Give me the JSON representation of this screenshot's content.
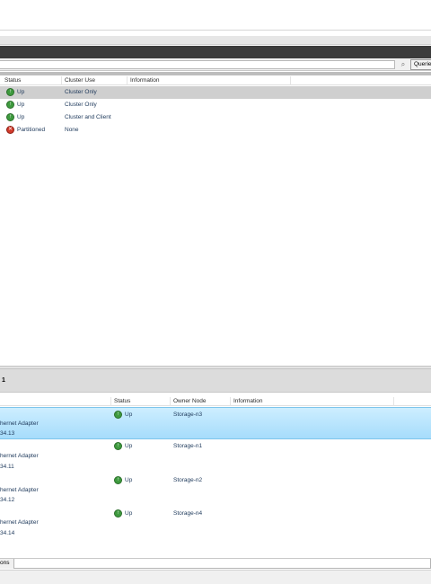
{
  "toolbar": {
    "queries_label": "Querie",
    "search_placeholder": ""
  },
  "networks": {
    "columns": [
      "Status",
      "Cluster Use",
      "Information"
    ],
    "rows": [
      {
        "status": "Up",
        "status_icon": "up-arrow-icon",
        "cluster_use": "Cluster Only",
        "information": ""
      },
      {
        "status": "Up",
        "status_icon": "up-arrow-icon",
        "cluster_use": "Cluster Only",
        "information": ""
      },
      {
        "status": "Up",
        "status_icon": "up-arrow-icon",
        "cluster_use": "Cluster and Client",
        "information": ""
      },
      {
        "status": "Partitioned",
        "status_icon": "error-x-icon",
        "cluster_use": "None",
        "information": ""
      }
    ]
  },
  "details": {
    "title": "1",
    "columns": [
      "Status",
      "Owner Node",
      "Information"
    ],
    "items": [
      {
        "name": "hernet Adapter",
        "address": "34.13",
        "status": "Up",
        "owner": "Storage-n3"
      },
      {
        "name": "hernet Adapter",
        "address": "34.11",
        "status": "Up",
        "owner": "Storage-n1"
      },
      {
        "name": "hernet Adapter",
        "address": "34.12",
        "status": "Up",
        "owner": "Storage-n2"
      },
      {
        "name": "hernet Adapter",
        "address": "34.14",
        "status": "Up",
        "owner": "Storage-n4"
      }
    ]
  },
  "bottom_tabs": {
    "tab1": "ons"
  },
  "colors": {
    "up": "#3e9a3e",
    "error": "#d23a2a",
    "selected": "#a6dcfb",
    "text": "#1e395b"
  }
}
